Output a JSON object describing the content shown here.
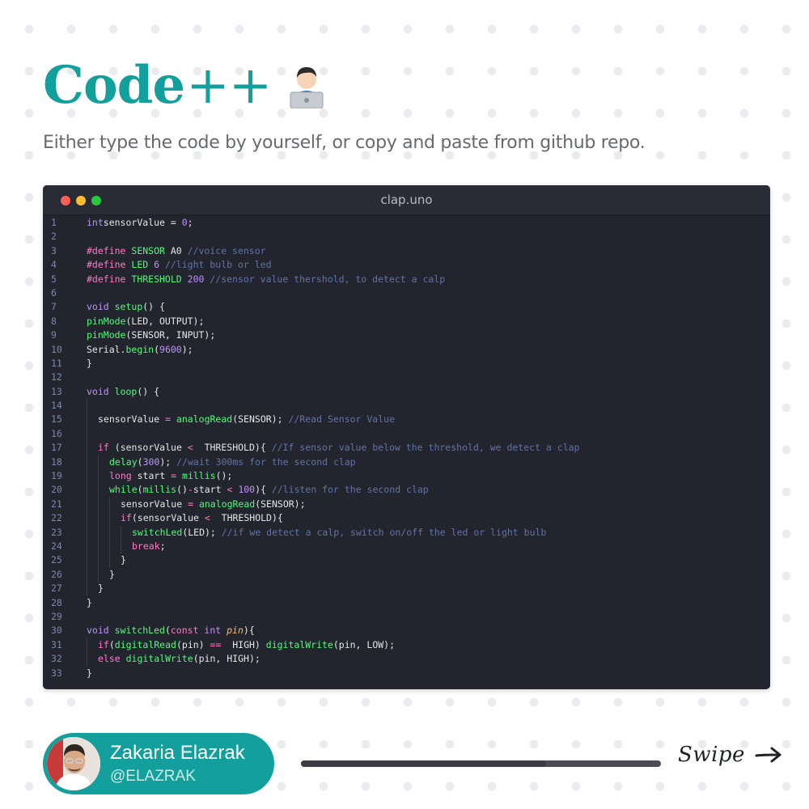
{
  "header": {
    "title": "Code",
    "title_suffix": "++",
    "emoji": "technologist-emoji",
    "subtitle": "Either type the code by yourself, or copy and paste from github repo."
  },
  "editor": {
    "filename": "clap.uno",
    "lines": [
      {
        "n": "1",
        "i": 0,
        "t": [
          [
            "kw2",
            "int"
          ],
          [
            "",
            "sensorValue = "
          ],
          [
            "num",
            "0"
          ],
          [
            "",
            ";"
          ]
        ]
      },
      {
        "n": "2",
        "i": 0,
        "t": []
      },
      {
        "n": "3",
        "i": 0,
        "t": [
          [
            "pp",
            "#define "
          ],
          [
            "fn",
            "SENSOR "
          ],
          [
            "",
            "A0 "
          ],
          [
            "cm",
            "//voice sensor"
          ]
        ]
      },
      {
        "n": "4",
        "i": 0,
        "t": [
          [
            "pp",
            "#define "
          ],
          [
            "fn",
            "LED "
          ],
          [
            "num",
            "6 "
          ],
          [
            "cm",
            "//light bulb or led"
          ]
        ]
      },
      {
        "n": "5",
        "i": 0,
        "t": [
          [
            "pp",
            "#define "
          ],
          [
            "fn",
            "THRESHOLD "
          ],
          [
            "num",
            "200 "
          ],
          [
            "cm",
            "//sensor value thershold, to detect a calp"
          ]
        ]
      },
      {
        "n": "6",
        "i": 0,
        "t": []
      },
      {
        "n": "7",
        "i": 0,
        "t": [
          [
            "kw2",
            "void "
          ],
          [
            "fn",
            "setup"
          ],
          [
            "",
            "() {"
          ]
        ]
      },
      {
        "n": "8",
        "i": 0,
        "t": [
          [
            "fn",
            "pinMode"
          ],
          [
            "",
            "(LED, OUTPUT);"
          ]
        ]
      },
      {
        "n": "9",
        "i": 0,
        "t": [
          [
            "fn",
            "pinMode"
          ],
          [
            "",
            "(SENSOR, INPUT);"
          ]
        ]
      },
      {
        "n": "10",
        "i": 0,
        "t": [
          [
            "",
            "Serial."
          ],
          [
            "fn",
            "begin"
          ],
          [
            "",
            "("
          ],
          [
            "num",
            "9600"
          ],
          [
            "",
            ");"
          ]
        ]
      },
      {
        "n": "11",
        "i": 0,
        "t": [
          [
            "",
            "}"
          ]
        ]
      },
      {
        "n": "12",
        "i": 0,
        "t": []
      },
      {
        "n": "13",
        "i": 0,
        "t": [
          [
            "kw2",
            "void "
          ],
          [
            "fn",
            "loop"
          ],
          [
            "",
            "() {"
          ]
        ]
      },
      {
        "n": "14",
        "i": 1,
        "t": []
      },
      {
        "n": "15",
        "i": 1,
        "t": [
          [
            "",
            "sensorValue "
          ],
          [
            "kw",
            "="
          ],
          [
            "",
            ""
          ],
          [
            "fn",
            " analogRead"
          ],
          [
            "",
            "(SENSOR); "
          ],
          [
            "cm",
            "//Read Sensor Value"
          ]
        ]
      },
      {
        "n": "16",
        "i": 1,
        "t": []
      },
      {
        "n": "17",
        "i": 1,
        "t": [
          [
            "kw",
            "if "
          ],
          [
            "",
            "(sensorValue "
          ],
          [
            "kw",
            "<"
          ],
          [
            "",
            ""
          ],
          [
            "",
            "  THRESHOLD){ "
          ],
          [
            "cm",
            "//If sensor value below the threshold, we detect a clap"
          ]
        ]
      },
      {
        "n": "18",
        "i": 2,
        "t": [
          [
            "fn",
            "delay"
          ],
          [
            "",
            "("
          ],
          [
            "num",
            "300"
          ],
          [
            "",
            "); "
          ],
          [
            "cm",
            "//wait 300ms for the second clap"
          ]
        ]
      },
      {
        "n": "19",
        "i": 2,
        "t": [
          [
            "kw",
            "long "
          ],
          [
            "",
            "start "
          ],
          [
            "kw",
            "="
          ],
          [
            "fn",
            " millis"
          ],
          [
            "",
            "();"
          ]
        ]
      },
      {
        "n": "20",
        "i": 2,
        "t": [
          [
            "fn",
            "while"
          ],
          [
            "",
            "("
          ],
          [
            "fn",
            "millis"
          ],
          [
            "",
            "()"
          ],
          [
            "kw",
            "-"
          ],
          [
            "",
            "start "
          ],
          [
            "kw",
            "<"
          ],
          [
            "num",
            " 100"
          ],
          [
            "",
            "){ "
          ],
          [
            "cm",
            "//listen for the second clap"
          ]
        ]
      },
      {
        "n": "21",
        "i": 3,
        "t": [
          [
            "",
            "sensorValue "
          ],
          [
            "kw",
            "="
          ],
          [
            "fn",
            " analogRead"
          ],
          [
            "",
            "(SENSOR);"
          ]
        ]
      },
      {
        "n": "22",
        "i": 3,
        "t": [
          [
            "kw",
            "if"
          ],
          [
            "",
            "(sensorValue "
          ],
          [
            "kw",
            "<"
          ],
          [
            "",
            "  THRESHOLD){"
          ]
        ]
      },
      {
        "n": "23",
        "i": 4,
        "t": [
          [
            "fn",
            "switchLed"
          ],
          [
            "",
            "(LED); "
          ],
          [
            "cm",
            "//if we detect a calp, switch on/off the led or light bulb"
          ]
        ]
      },
      {
        "n": "24",
        "i": 4,
        "t": [
          [
            "kw",
            "break"
          ],
          [
            "",
            ";"
          ]
        ]
      },
      {
        "n": "25",
        "i": 3,
        "t": [
          [
            "",
            "}"
          ]
        ]
      },
      {
        "n": "26",
        "i": 2,
        "t": [
          [
            "",
            "}"
          ]
        ]
      },
      {
        "n": "27",
        "i": 1,
        "t": [
          [
            "",
            "}"
          ]
        ]
      },
      {
        "n": "28",
        "i": 0,
        "t": [
          [
            "",
            "}"
          ]
        ]
      },
      {
        "n": "29",
        "i": 0,
        "t": []
      },
      {
        "n": "30",
        "i": 0,
        "t": [
          [
            "kw2",
            "void "
          ],
          [
            "fn",
            "switchLed"
          ],
          [
            "",
            "("
          ],
          [
            "kw",
            "const "
          ],
          [
            "kw2",
            "int "
          ],
          [
            "prm",
            "pin"
          ],
          [
            "",
            "){"
          ]
        ]
      },
      {
        "n": "31",
        "i": 1,
        "t": [
          [
            "kw",
            "if"
          ],
          [
            "",
            "("
          ],
          [
            "fn",
            "digitalRead"
          ],
          [
            "",
            "(pin) "
          ],
          [
            "kw",
            "=="
          ],
          [
            "",
            ""
          ],
          [
            "",
            "  HIGH) "
          ],
          [
            "fn",
            "digitalWrite"
          ],
          [
            "",
            "(pin, LOW);"
          ]
        ]
      },
      {
        "n": "32",
        "i": 1,
        "t": [
          [
            "kw",
            "else "
          ],
          [
            "fn",
            "digitalWrite"
          ],
          [
            "",
            "(pin, HIGH);"
          ]
        ]
      },
      {
        "n": "33",
        "i": 0,
        "t": [
          [
            "",
            "}"
          ]
        ]
      }
    ]
  },
  "author": {
    "name": "Zakaria Elazrak",
    "handle": "@ELAZRAK",
    "avatar": "avatar-photo"
  },
  "footer": {
    "progress": 0.68,
    "swipe_label": "Swipe",
    "swipe_icon": "arrow-right-icon"
  },
  "colors": {
    "accent": "#13a09c",
    "editor_bg": "#23252e"
  }
}
